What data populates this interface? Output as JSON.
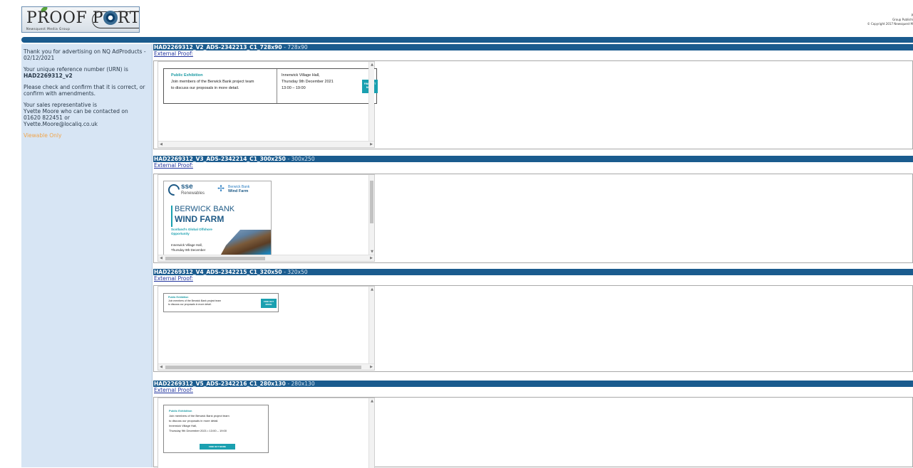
{
  "header": {
    "logo_text_left": "PR",
    "logo_text_mid": "OOF P",
    "logo_text_right": "RTAL",
    "logo_subtitle": "Newsquest Media Group",
    "copyright_line1": "P",
    "copyright_line2": "Group Publishi",
    "copyright_line3": "© Copyright 2017 Newsquest M"
  },
  "sidebar": {
    "thanks": "Thank you for advertising on NQ AdProducts - 02/12/2021",
    "urn_intro": "Your unique reference number (URN) is",
    "urn": "HAD2269312_v2",
    "check": "Please check and confirm that it is correct, or confirm with amendments.",
    "rep_intro": "Your sales representative is",
    "rep_line": "Yvette Moore who can be contacted on",
    "rep_phone": "01620 822451 or",
    "rep_email": "Yvette.Moore@localiq.co.uk",
    "status": "Viewable Only"
  },
  "sections": [
    {
      "title": "HAD2269312_V2_ADS-2342213_C1_728x90",
      "dims": "- 728x90",
      "link": "External Proof:"
    },
    {
      "title": "HAD2269312_V3_ADS-2342214_C1_300x250",
      "dims": "- 300x250",
      "link": "External Proof:"
    },
    {
      "title": "HAD2269312_V4_ADS-2342215_C1_320x50",
      "dims": "- 320x50",
      "link": "External Proof:"
    },
    {
      "title": "HAD2269312_V5_ADS-2342216_C1_280x130",
      "dims": "- 280x130",
      "link": "External Proof:"
    }
  ],
  "ads": {
    "public_exhibition": "Public Exhibition",
    "join_line1": "Join members of the Berwick Bank project team",
    "join_line2": "to discuss our proposals in more detail.",
    "venue": "Innerwick Village Hall,",
    "date": "Thursday 9th December 2021",
    "time": "13:00 – 19:00",
    "date_time": "Thursday 9th December 2021 • 13:00 – 19:00",
    "date_short": "Thursday 9th December",
    "find_out_more": "FIND OUT MORE",
    "find_out_short1": "FIND OUT",
    "find_out_short2": "MORE",
    "sse": "sse",
    "renewables": "Renewables",
    "berwick_bank_small": "Berwick Bank",
    "wind_farm_small": "Wind Farm",
    "berwick_bank": "BERWICK BANK",
    "wind_farm": "WIND FARM",
    "scotland1": "Scotland's Global Offshore",
    "scotland2": "Opportunity",
    "brand_color": "#1aa0b0"
  }
}
